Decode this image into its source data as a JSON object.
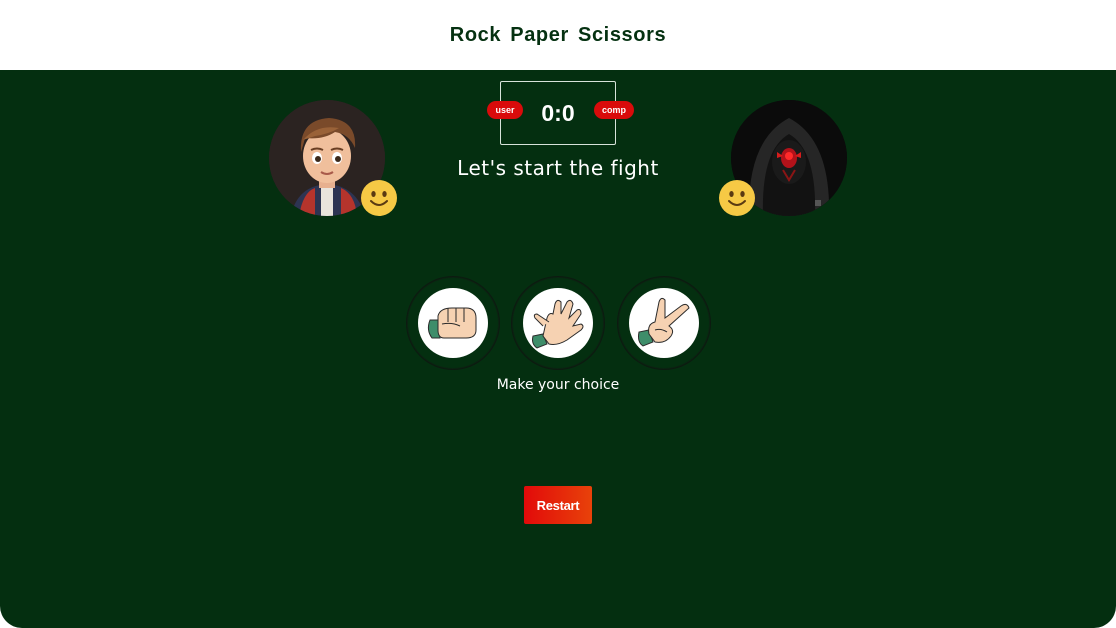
{
  "header": {
    "title": "Rock Paper Scissors"
  },
  "score": {
    "display": "0:0",
    "user_label": "user",
    "comp_label": "comp"
  },
  "message": "Let's start the fight",
  "players": {
    "user": {
      "avatar": "boy-avatar",
      "mood": "smiley-emoji"
    },
    "comp": {
      "avatar": "hooded-robot-avatar",
      "mood": "smiley-emoji"
    }
  },
  "choices": [
    {
      "id": "rock",
      "icon": "rock-hand-icon"
    },
    {
      "id": "paper",
      "icon": "paper-hand-icon"
    },
    {
      "id": "scissors",
      "icon": "scissors-hand-icon"
    }
  ],
  "prompt": "Make your choice",
  "restart_label": "Restart",
  "colors": {
    "board": "#042f10",
    "title": "#053111",
    "badge": "#d90b0b",
    "restart": "#e20a0a",
    "emoji": "#f6c945"
  }
}
